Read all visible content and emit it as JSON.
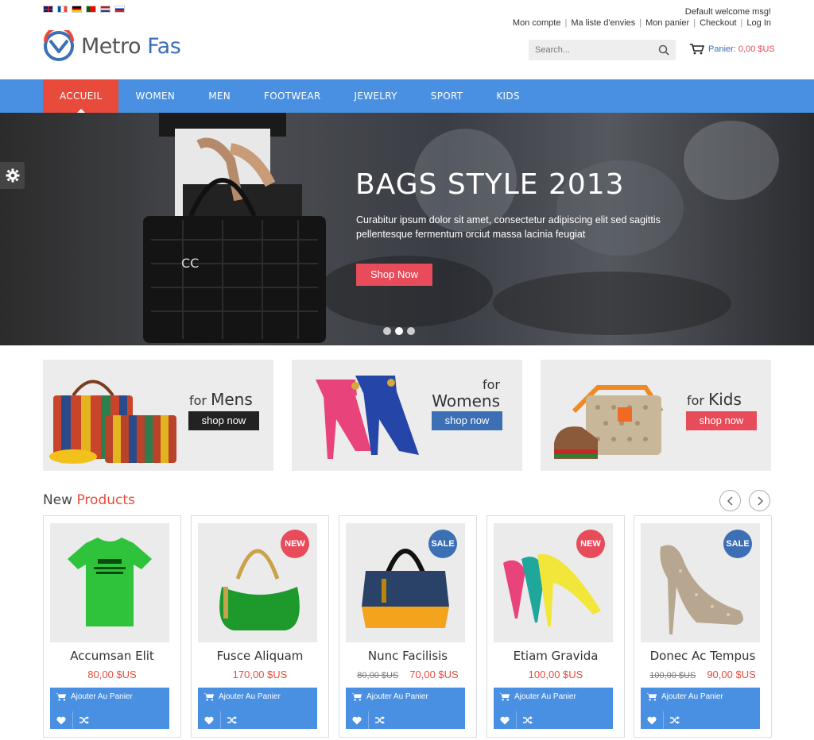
{
  "header": {
    "logo_text_main": "Metro ",
    "logo_text_accent": "Fas",
    "welcome": "Default welcome msg!",
    "account_links": [
      "Mon compte",
      "Ma liste d'envies",
      "Mon panier",
      "Checkout",
      "Log In"
    ],
    "search_placeholder": "Search...",
    "cart_label": "Panier:",
    "cart_amount": "0,00 $US",
    "languages": [
      "en",
      "fr",
      "de",
      "pt",
      "nl",
      "ru"
    ]
  },
  "nav": {
    "items": [
      "ACCUEIL",
      "WOMEN",
      "MEN",
      "FOOTWEAR",
      "JEWELRY",
      "SPORT",
      "KIDS"
    ],
    "active_index": 0
  },
  "hero": {
    "title": "BAGS STYLE 2013",
    "text": "Curabitur ipsum dolor sit amet, consectetur adipiscing elit sed sagittis pellentesque fermentum orciut massa lacinia feugiat",
    "button": "Shop Now",
    "slides": 3,
    "active_slide": 1
  },
  "banners": [
    {
      "prefix": "for ",
      "title": "Mens",
      "button": "shop now",
      "button_color": "#222222"
    },
    {
      "prefix": "for",
      "title": "Womens",
      "button": "shop now",
      "button_color": "#3d6fb5"
    },
    {
      "prefix": "for ",
      "title": "Kids",
      "button": "shop now",
      "button_color": "#e84b5a"
    }
  ],
  "products_section": {
    "title_main": "New ",
    "title_accent": "Products"
  },
  "products": [
    {
      "name": "Accumsan Elit",
      "price": "80,00 $US",
      "old_price": "",
      "badge": "",
      "add_to_cart": "Ajouter Au Panier"
    },
    {
      "name": "Fusce Aliquam",
      "price": "170,00 $US",
      "old_price": "",
      "badge": "NEW",
      "add_to_cart": "Ajouter Au Panier"
    },
    {
      "name": "Nunc Facilisis",
      "price": "70,00 $US",
      "old_price": "80,00 $US",
      "badge": "SALE",
      "add_to_cart": "Ajouter Au Panier"
    },
    {
      "name": "Etiam Gravida",
      "price": "100,00 $US",
      "old_price": "",
      "badge": "NEW",
      "add_to_cart": "Ajouter Au Panier"
    },
    {
      "name": "Donec Ac Tempus",
      "price": "90,00 $US",
      "old_price": "100,00 $US",
      "badge": "SALE",
      "add_to_cart": "Ajouter Au Panier"
    }
  ],
  "colors": {
    "primary_blue": "#4a90e2",
    "accent_red": "#e84b3c",
    "badge_pink": "#e84b5a",
    "badge_blue": "#3d6fb5"
  }
}
